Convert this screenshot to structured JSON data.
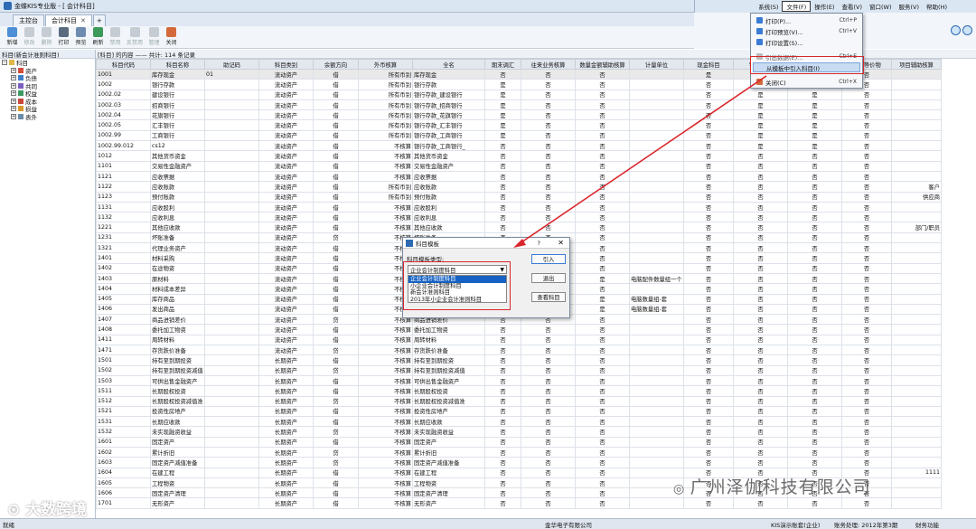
{
  "window": {
    "title": "金蝶KIS专业版 - [ 会计科目]"
  },
  "tabs": [
    {
      "label": "主控台"
    },
    {
      "label": "会计科目"
    }
  ],
  "toolbar": [
    {
      "label": "新增",
      "icon": "new-icon",
      "enabled": true
    },
    {
      "label": "修改",
      "icon": "edit-icon",
      "enabled": false
    },
    {
      "label": "删除",
      "icon": "delete-icon",
      "enabled": false
    },
    {
      "label": "打印",
      "icon": "print-icon",
      "enabled": true
    },
    {
      "label": "预览",
      "icon": "preview-icon",
      "enabled": true
    },
    {
      "label": "刷新",
      "icon": "refresh-icon",
      "enabled": true
    },
    {
      "label": "禁用",
      "icon": "disable-icon",
      "enabled": false
    },
    {
      "label": "反禁用",
      "icon": "enable-icon",
      "enabled": false
    },
    {
      "label": "管理",
      "icon": "manage-icon",
      "enabled": false
    },
    {
      "label": "关闭",
      "icon": "close-icon",
      "enabled": true
    }
  ],
  "menubar": [
    {
      "label": "系统(S)"
    },
    {
      "label": "文件(F)"
    },
    {
      "label": "操作(E)"
    },
    {
      "label": "查看(V)"
    },
    {
      "label": "窗口(W)"
    },
    {
      "label": "服务(V)"
    },
    {
      "label": "帮助(H)"
    }
  ],
  "file_menu": [
    {
      "label": "打印(P)...",
      "shortcut": "Ctrl+P"
    },
    {
      "label": "打印预览(V)...",
      "shortcut": "Ctrl+V"
    },
    {
      "label": "打印设置(S)...",
      "shortcut": ""
    },
    {
      "label": "引出数据(E)...",
      "shortcut": "Ctrl+E"
    },
    {
      "label": "从模板中引入科目(I)",
      "shortcut": ""
    },
    {
      "label": "关闭(C)",
      "shortcut": "Ctrl+X"
    }
  ],
  "tree": {
    "header": "科目(新会计准则科目)",
    "root": "科目",
    "items": [
      "资产",
      "负债",
      "共同",
      "权益",
      "成本",
      "损益",
      "表外"
    ]
  },
  "grid": {
    "info": "[科目] 的内容 —— 共计: 114 条记录",
    "columns": [
      "科目代码",
      "科目名称",
      "助记码",
      "科目类别",
      "余额方向",
      "外币核算",
      "全名",
      "期末调汇",
      "往来业务核算",
      "数量金额辅助核算",
      "计量单位",
      "现金科目",
      "银行科目",
      "出日记账",
      "现金等价物",
      "项目辅助核算"
    ],
    "rows": [
      [
        "1001",
        "库存现金",
        "01",
        "流动资产",
        "借",
        "所有币别",
        "库存现金",
        "否",
        "否",
        "否",
        "",
        "是",
        "否",
        "是",
        "否",
        ""
      ],
      [
        "1002",
        "银行存款",
        "",
        "流动资产",
        "借",
        "所有币别",
        "银行存款",
        "是",
        "否",
        "否",
        "",
        "否",
        "是",
        "是",
        "否",
        ""
      ],
      [
        "1002.02",
        "建设银行",
        "",
        "流动资产",
        "借",
        "所有币别",
        "银行存款_建设银行",
        "是",
        "否",
        "否",
        "",
        "否",
        "是",
        "是",
        "否",
        ""
      ],
      [
        "1002.03",
        "招商银行",
        "",
        "流动资产",
        "借",
        "所有币别",
        "银行存款_招商银行",
        "是",
        "否",
        "否",
        "",
        "否",
        "是",
        "是",
        "否",
        ""
      ],
      [
        "1002.04",
        "花旗银行",
        "",
        "流动资产",
        "借",
        "所有币别",
        "银行存款_花旗银行",
        "是",
        "否",
        "否",
        "",
        "否",
        "是",
        "是",
        "否",
        ""
      ],
      [
        "1002.05",
        "汇丰银行",
        "",
        "流动资产",
        "借",
        "所有币别",
        "银行存款_汇丰银行",
        "是",
        "否",
        "否",
        "",
        "否",
        "是",
        "是",
        "否",
        ""
      ],
      [
        "1002.99",
        "工商银行",
        "",
        "流动资产",
        "借",
        "所有币别",
        "银行存款_工商银行",
        "是",
        "否",
        "否",
        "",
        "否",
        "是",
        "是",
        "否",
        ""
      ],
      [
        "1002.99.012",
        "cs12",
        "",
        "流动资产",
        "借",
        "不核算",
        "银行存款_工商银行_",
        "否",
        "否",
        "否",
        "",
        "否",
        "是",
        "是",
        "否",
        ""
      ],
      [
        "1012",
        "其他货币资金",
        "",
        "流动资产",
        "借",
        "不核算",
        "其他货币资金",
        "否",
        "否",
        "否",
        "",
        "否",
        "否",
        "否",
        "否",
        ""
      ],
      [
        "1101",
        "交易性金融资产",
        "",
        "流动资产",
        "借",
        "不核算",
        "交易性金融资产",
        "否",
        "否",
        "否",
        "",
        "否",
        "否",
        "否",
        "否",
        ""
      ],
      [
        "1121",
        "应收票据",
        "",
        "流动资产",
        "借",
        "不核算",
        "应收票据",
        "否",
        "否",
        "否",
        "",
        "否",
        "否",
        "否",
        "否",
        ""
      ],
      [
        "1122",
        "应收账款",
        "",
        "流动资产",
        "借",
        "所有币别",
        "应收账款",
        "否",
        "否",
        "否",
        "",
        "否",
        "否",
        "否",
        "否",
        "客户"
      ],
      [
        "1123",
        "预付账款",
        "",
        "流动资产",
        "借",
        "所有币别",
        "预付账款",
        "否",
        "否",
        "否",
        "",
        "否",
        "否",
        "否",
        "否",
        "供应商"
      ],
      [
        "1131",
        "应收股利",
        "",
        "流动资产",
        "借",
        "不核算",
        "应收股利",
        "否",
        "否",
        "否",
        "",
        "否",
        "否",
        "否",
        "否",
        ""
      ],
      [
        "1132",
        "应收利息",
        "",
        "流动资产",
        "借",
        "不核算",
        "应收利息",
        "否",
        "否",
        "否",
        "",
        "否",
        "否",
        "否",
        "否",
        ""
      ],
      [
        "1221",
        "其他应收款",
        "",
        "流动资产",
        "借",
        "不核算",
        "其他应收款",
        "否",
        "否",
        "否",
        "",
        "否",
        "否",
        "否",
        "否",
        "部门/职员"
      ],
      [
        "1231",
        "坏账准备",
        "",
        "流动资产",
        "贷",
        "不核算",
        "坏账准备",
        "否",
        "否",
        "否",
        "",
        "否",
        "否",
        "否",
        "否",
        ""
      ],
      [
        "1321",
        "代理业务资产",
        "",
        "流动资产",
        "借",
        "不核算",
        "代理业务资产",
        "否",
        "否",
        "否",
        "",
        "否",
        "否",
        "否",
        "否",
        ""
      ],
      [
        "1401",
        "材料采购",
        "",
        "流动资产",
        "借",
        "不核算",
        "材料采购",
        "否",
        "否",
        "否",
        "",
        "否",
        "否",
        "否",
        "否",
        ""
      ],
      [
        "1402",
        "在途物资",
        "",
        "流动资产",
        "借",
        "不核算",
        "在途物资",
        "否",
        "否",
        "否",
        "",
        "否",
        "否",
        "否",
        "否",
        ""
      ],
      [
        "1403",
        "原材料",
        "",
        "流动资产",
        "借",
        "不核算",
        "原材料",
        "否",
        "否",
        "是",
        "电脑配件数量组一个",
        "否",
        "否",
        "否",
        "否",
        ""
      ],
      [
        "1404",
        "材料成本差异",
        "",
        "流动资产",
        "借",
        "不核算",
        "材料成本差异",
        "否",
        "否",
        "否",
        "",
        "否",
        "否",
        "否",
        "否",
        ""
      ],
      [
        "1405",
        "库存商品",
        "",
        "流动资产",
        "借",
        "不核算",
        "库存商品",
        "否",
        "否",
        "是",
        "电脑数量组-套",
        "否",
        "否",
        "否",
        "否",
        ""
      ],
      [
        "1406",
        "发出商品",
        "",
        "流动资产",
        "借",
        "不核算",
        "发出商品",
        "否",
        "否",
        "是",
        "电脑数量组-套",
        "否",
        "否",
        "否",
        "否",
        ""
      ],
      [
        "1407",
        "商品进销差价",
        "",
        "流动资产",
        "贷",
        "不核算",
        "商品进销差价",
        "否",
        "否",
        "否",
        "",
        "否",
        "否",
        "否",
        "否",
        ""
      ],
      [
        "1408",
        "委托加工物资",
        "",
        "流动资产",
        "借",
        "不核算",
        "委托加工物资",
        "否",
        "否",
        "否",
        "",
        "否",
        "否",
        "否",
        "否",
        ""
      ],
      [
        "1411",
        "周转材料",
        "",
        "流动资产",
        "借",
        "不核算",
        "周转材料",
        "否",
        "否",
        "否",
        "",
        "否",
        "否",
        "否",
        "否",
        ""
      ],
      [
        "1471",
        "存货跌价准备",
        "",
        "流动资产",
        "贷",
        "不核算",
        "存货跌价准备",
        "否",
        "否",
        "否",
        "",
        "否",
        "否",
        "否",
        "否",
        ""
      ],
      [
        "1501",
        "持有至到期投资",
        "",
        "长期资产",
        "借",
        "不核算",
        "持有至到期投资",
        "否",
        "否",
        "否",
        "",
        "否",
        "否",
        "否",
        "否",
        ""
      ],
      [
        "1502",
        "持有至到期投资减值",
        "",
        "长期资产",
        "贷",
        "不核算",
        "持有至到期投资减值",
        "否",
        "否",
        "否",
        "",
        "否",
        "否",
        "否",
        "否",
        ""
      ],
      [
        "1503",
        "可供出售金融资产",
        "",
        "长期资产",
        "借",
        "不核算",
        "可供出售金融资产",
        "否",
        "否",
        "否",
        "",
        "否",
        "否",
        "否",
        "否",
        ""
      ],
      [
        "1511",
        "长期股权投资",
        "",
        "长期资产",
        "借",
        "不核算",
        "长期股权投资",
        "否",
        "否",
        "否",
        "",
        "否",
        "否",
        "否",
        "否",
        ""
      ],
      [
        "1512",
        "长期股权投资减值准",
        "",
        "长期资产",
        "贷",
        "不核算",
        "长期股权投资减值准",
        "否",
        "否",
        "否",
        "",
        "否",
        "否",
        "否",
        "否",
        ""
      ],
      [
        "1521",
        "投资性房地产",
        "",
        "长期资产",
        "借",
        "不核算",
        "投资性房地产",
        "否",
        "否",
        "否",
        "",
        "否",
        "否",
        "否",
        "否",
        ""
      ],
      [
        "1531",
        "长期应收款",
        "",
        "长期资产",
        "借",
        "不核算",
        "长期应收款",
        "否",
        "否",
        "否",
        "",
        "否",
        "否",
        "否",
        "否",
        ""
      ],
      [
        "1532",
        "未实现融资收益",
        "",
        "长期资产",
        "贷",
        "不核算",
        "未实现融资收益",
        "否",
        "否",
        "否",
        "",
        "否",
        "否",
        "否",
        "否",
        ""
      ],
      [
        "1601",
        "固定资产",
        "",
        "长期资产",
        "借",
        "不核算",
        "固定资产",
        "否",
        "否",
        "否",
        "",
        "否",
        "否",
        "否",
        "否",
        ""
      ],
      [
        "1602",
        "累计折旧",
        "",
        "长期资产",
        "贷",
        "不核算",
        "累计折旧",
        "否",
        "否",
        "否",
        "",
        "否",
        "否",
        "否",
        "否",
        ""
      ],
      [
        "1603",
        "固定资产减值准备",
        "",
        "长期资产",
        "贷",
        "不核算",
        "固定资产减值准备",
        "否",
        "否",
        "否",
        "",
        "否",
        "否",
        "否",
        "否",
        ""
      ],
      [
        "1604",
        "在建工程",
        "",
        "长期资产",
        "借",
        "不核算",
        "在建工程",
        "否",
        "否",
        "否",
        "",
        "否",
        "否",
        "否",
        "否",
        "1111"
      ],
      [
        "1605",
        "工程物资",
        "",
        "长期资产",
        "借",
        "不核算",
        "工程物资",
        "否",
        "否",
        "否",
        "",
        "否",
        "否",
        "否",
        "否",
        ""
      ],
      [
        "1606",
        "固定资产清理",
        "",
        "长期资产",
        "借",
        "不核算",
        "固定资产清理",
        "否",
        "否",
        "否",
        "",
        "否",
        "否",
        "否",
        "否",
        ""
      ],
      [
        "1701",
        "无形资产",
        "",
        "长期资产",
        "借",
        "不核算",
        "无形资产",
        "否",
        "否",
        "否",
        "",
        "否",
        "否",
        "否",
        "否",
        ""
      ]
    ]
  },
  "dialog": {
    "title": "科目模板",
    "help": "?",
    "label": "科目模板类型:",
    "selected": "企业会计制度科目",
    "options": [
      "企业会计制度科目",
      "小企业会计制度科目",
      "新会计准则科目",
      "2013年小企业会计准则科目"
    ],
    "buttons": {
      "import": "引入",
      "exit": "退出",
      "view": "查看科目"
    }
  },
  "status": {
    "left": "就绪",
    "company": "金华电子有限公司",
    "account_set": "KIS演示账套(企业)",
    "period": "账务处理: 2012年第3期",
    "feature": "财务功能"
  },
  "watermarks": {
    "company": "广州泽伽科技有限公司",
    "brand": "大数跨境"
  },
  "colors": {
    "highlight_red": "#d9262b",
    "selection_blue": "#1662c4",
    "accent": "#2d6bb3"
  }
}
